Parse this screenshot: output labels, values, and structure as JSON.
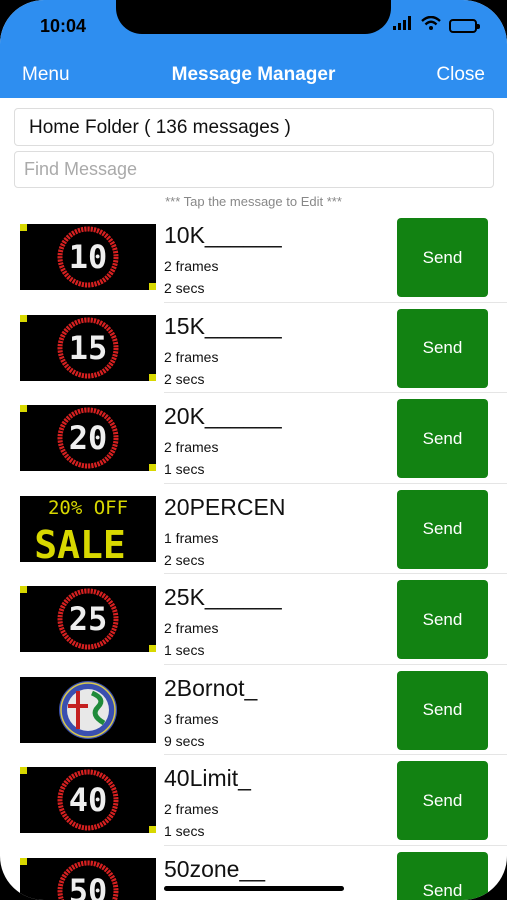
{
  "status_bar": {
    "time": "10:04"
  },
  "nav": {
    "left": "Menu",
    "title": "Message Manager",
    "right": "Close"
  },
  "folder": {
    "label": "Home Folder ( 136 messages )"
  },
  "search": {
    "placeholder": "Find Message",
    "value": ""
  },
  "hint": "*** Tap the message to Edit ***",
  "send_label": "Send",
  "messages": [
    {
      "name": "10K______",
      "frames": "2 frames",
      "secs": "2 secs",
      "thumb": {
        "kind": "speed",
        "text": "10"
      }
    },
    {
      "name": "15K______",
      "frames": "2 frames",
      "secs": "2 secs",
      "thumb": {
        "kind": "speed",
        "text": "15"
      }
    },
    {
      "name": "20K______",
      "frames": "2 frames",
      "secs": "1 secs",
      "thumb": {
        "kind": "speed",
        "text": "20"
      }
    },
    {
      "name": "20PERCEN",
      "frames": "1 frames",
      "secs": "2 secs",
      "thumb": {
        "kind": "sale",
        "line1": "20% OFF",
        "line2": "SALE"
      }
    },
    {
      "name": "25K______",
      "frames": "2 frames",
      "secs": "1 secs",
      "thumb": {
        "kind": "speed",
        "text": "25"
      }
    },
    {
      "name": "2Bornot_",
      "frames": "3 frames",
      "secs": "9 secs",
      "thumb": {
        "kind": "logo"
      }
    },
    {
      "name": "40Limit_",
      "frames": "2 frames",
      "secs": "1 secs",
      "thumb": {
        "kind": "speed",
        "text": "40"
      }
    },
    {
      "name": "50zone__",
      "frames": "",
      "secs": "",
      "thumb": {
        "kind": "speed",
        "text": "50"
      }
    }
  ],
  "colors": {
    "header": "#2e8ef0",
    "send": "#128212",
    "ring": "#d62020",
    "amber": "#d8d800"
  }
}
